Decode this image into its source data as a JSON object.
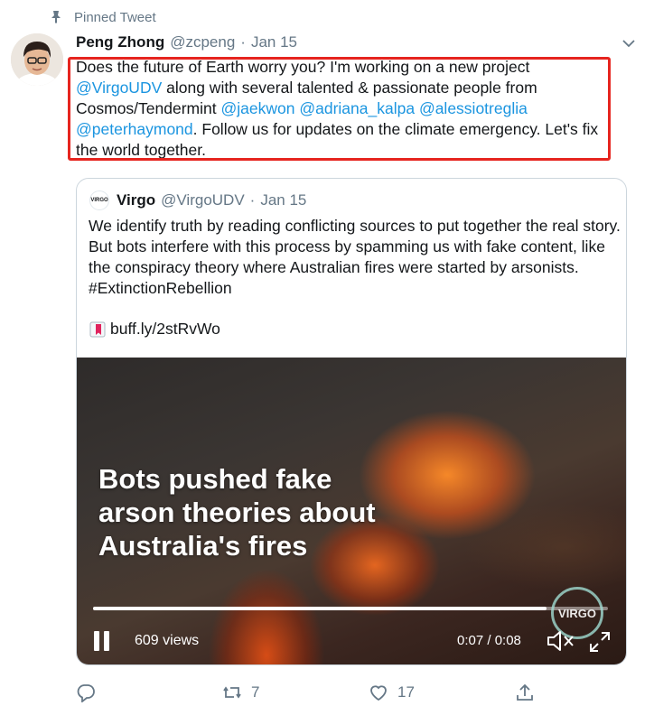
{
  "pinned": {
    "label": "Pinned Tweet",
    "icon": "pin-icon"
  },
  "tweet": {
    "author_name": "Peng Zhong",
    "author_handle": "@zcpeng",
    "separator": "·",
    "date": "Jan 15",
    "text_parts": [
      {
        "text": "Does the future of Earth worry you? I'm working on a new project ",
        "link": false
      },
      {
        "text": "@VirgoUDV",
        "link": true
      },
      {
        "text": " along with several talented & passionate people from Cosmos/Tendermint ",
        "link": false
      },
      {
        "text": "@jaekwon",
        "link": true
      },
      {
        "text": " ",
        "link": false
      },
      {
        "text": "@adriana_kalpa",
        "link": true
      },
      {
        "text": " ",
        "link": false
      },
      {
        "text": "@alessiotreglia",
        "link": true
      },
      {
        "text": " ",
        "link": false
      },
      {
        "text": "@peterhaymond",
        "link": true
      },
      {
        "text": ". Follow us for updates on the climate emergency. Let's fix the world together.",
        "link": false
      }
    ]
  },
  "quote": {
    "avatar_text": "VIRGO",
    "author_name": "Virgo",
    "author_handle": "@VirgoUDV",
    "separator": "·",
    "date": "Jan 15",
    "text": "We identify truth by reading conflicting sources to put together the real story. But bots interfere with this process by spamming us with fake content, like the conspiracy theory where Australian fires were started by arsonists. #ExtinctionRebellion",
    "link_text": "buff.ly/2stRvWo",
    "link_icon": "bookmark-link-icon"
  },
  "video": {
    "caption_lines": [
      "Bots pushed fake",
      "arson theories about",
      "Australia's fires"
    ],
    "watermark": "VIRGO",
    "views": "609 views",
    "time": "0:07 / 0:08",
    "progress": 0.88
  },
  "actions": {
    "reply": {
      "icon": "reply-icon",
      "count": ""
    },
    "retweet": {
      "icon": "retweet-icon",
      "count": "7"
    },
    "like": {
      "icon": "heart-icon",
      "count": "17"
    },
    "share": {
      "icon": "share-icon",
      "count": ""
    }
  },
  "colors": {
    "link": "#1b95e0",
    "muted": "#657786",
    "highlight": "#e6251f",
    "border": "#ccd6dd"
  }
}
